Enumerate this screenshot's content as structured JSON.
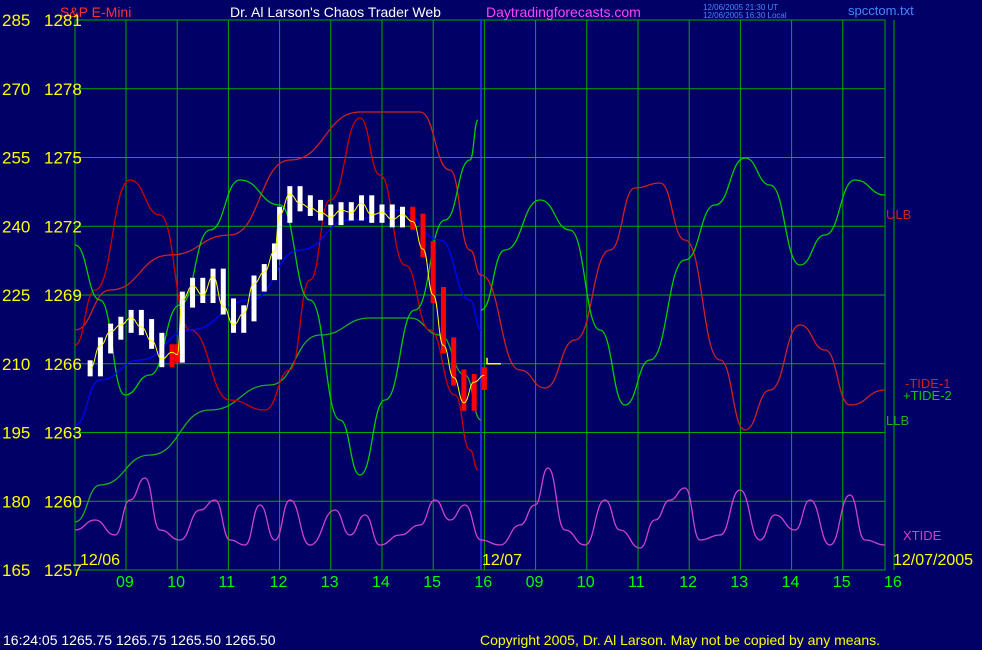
{
  "header": {
    "symbol": "S&P E-Mini",
    "title": "Dr. Al Larson's Chaos Trader Web",
    "site": "Daytradingforecasts.com",
    "utc_time": "12/06/2005 21:30 UT",
    "local_time": "12/06/2005 16:30 Local",
    "file": "spcctom.txt"
  },
  "footer": {
    "quote": "16:24:05  1265.75 1265.75 1265.50 1265.50",
    "copyright": "Copyright 2005, Dr. Al Larson. May not be copied by any means."
  },
  "colors": {
    "background": "#000066",
    "grid": "#00aa00",
    "tide_scale": "#ffff00",
    "price_scale": "#ffff00",
    "time_labels": "#00ff00",
    "ulb": "#cc2222",
    "llb": "#22aa22",
    "xtide": "#cc44cc",
    "tide_plus": "#00cc00",
    "tide_minus": "#cc0000",
    "ma": "#0000ff",
    "bars_up": "#ffffff",
    "bars_down": "#ff0000",
    "header_title": "#ffffff",
    "header_site": "#ff44ff",
    "header_symbol": "#ff3333",
    "header_file": "#4488ff",
    "copyright": "#ffff00"
  },
  "chart_data": {
    "type": "line",
    "title": "Dr. Al Larson's Chaos Trader Web",
    "y_left_tide_ticks": [
      "285",
      "270",
      "255",
      "240",
      "225",
      "210",
      "195",
      "180",
      "165"
    ],
    "y_right_price_ticks": [
      "1281",
      "1278",
      "1275",
      "1272",
      "1269",
      "1266",
      "1263",
      "1260",
      "1257"
    ],
    "ylim_price": [
      1257,
      1281
    ],
    "ylim_tide": [
      165,
      285
    ],
    "x_ticks": [
      "09",
      "10",
      "11",
      "12",
      "13",
      "14",
      "15",
      "16",
      "09",
      "10",
      "11",
      "12",
      "13",
      "14",
      "15",
      "16"
    ],
    "date_labels": [
      "12/06",
      "12/07",
      "12/07/2005"
    ],
    "x_range_hours": [
      8.0,
      16.0
    ],
    "series_labels": {
      "ulb": "ULB",
      "llb": "LLB",
      "tide_minus": "-TIDE-1",
      "tide_plus": "+TIDE-2",
      "xtide": "XTIDE"
    },
    "last_price": 1266.0,
    "price_bars": [
      {
        "t": 8.3,
        "c": 1265.8
      },
      {
        "t": 8.5,
        "c": 1266.8
      },
      {
        "t": 8.7,
        "c": 1267.4
      },
      {
        "t": 8.9,
        "c": 1267.7
      },
      {
        "t": 9.1,
        "c": 1268.0
      },
      {
        "t": 9.3,
        "c": 1267.6
      },
      {
        "t": 9.5,
        "c": 1267.0
      },
      {
        "t": 9.7,
        "c": 1266.2
      },
      {
        "t": 9.9,
        "c": 1266.5
      },
      {
        "t": 10.0,
        "c": 1266.4
      },
      {
        "t": 10.1,
        "c": 1268.8
      },
      {
        "t": 10.3,
        "c": 1269.4
      },
      {
        "t": 10.5,
        "c": 1269.0
      },
      {
        "t": 10.7,
        "c": 1269.8
      },
      {
        "t": 10.9,
        "c": 1268.5
      },
      {
        "t": 11.1,
        "c": 1267.7
      },
      {
        "t": 11.3,
        "c": 1268.2
      },
      {
        "t": 11.5,
        "c": 1269.5
      },
      {
        "t": 11.7,
        "c": 1270.0
      },
      {
        "t": 11.9,
        "c": 1270.9
      },
      {
        "t": 12.0,
        "c": 1272.5
      },
      {
        "t": 12.2,
        "c": 1273.4
      },
      {
        "t": 12.4,
        "c": 1273.0
      },
      {
        "t": 12.6,
        "c": 1272.8
      },
      {
        "t": 12.8,
        "c": 1272.6
      },
      {
        "t": 13.0,
        "c": 1272.4
      },
      {
        "t": 13.2,
        "c": 1272.7
      },
      {
        "t": 13.4,
        "c": 1272.6
      },
      {
        "t": 13.6,
        "c": 1273.0
      },
      {
        "t": 13.8,
        "c": 1272.5
      },
      {
        "t": 14.0,
        "c": 1272.6
      },
      {
        "t": 14.2,
        "c": 1272.3
      },
      {
        "t": 14.4,
        "c": 1272.5
      },
      {
        "t": 14.6,
        "c": 1272.2
      },
      {
        "t": 14.8,
        "c": 1271.0
      },
      {
        "t": 15.0,
        "c": 1269.0
      },
      {
        "t": 15.2,
        "c": 1266.8
      },
      {
        "t": 15.4,
        "c": 1265.4
      },
      {
        "t": 15.6,
        "c": 1264.3
      },
      {
        "t": 15.8,
        "c": 1265.2
      },
      {
        "t": 16.0,
        "c": 1265.5
      }
    ]
  }
}
